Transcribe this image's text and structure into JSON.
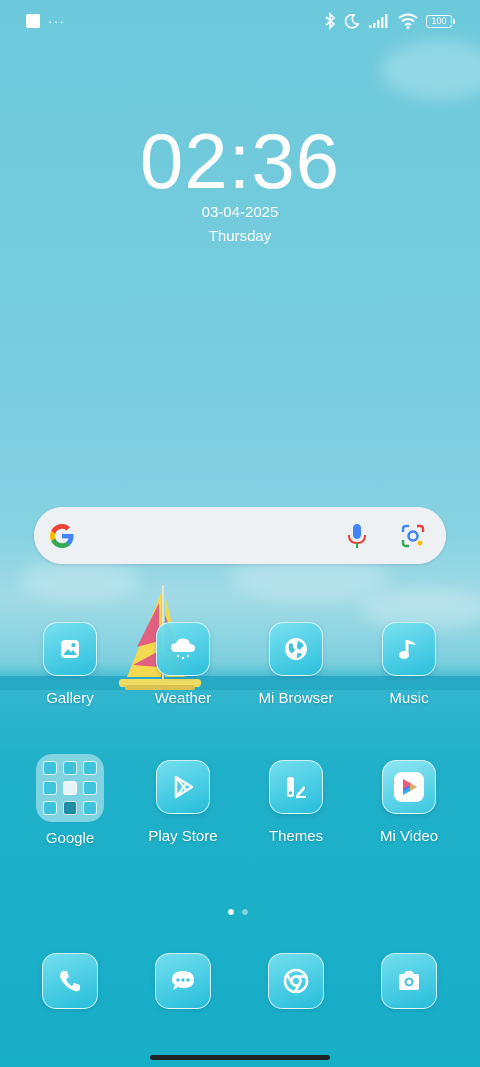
{
  "status_bar": {
    "more_indicator": "···",
    "battery_level": "100",
    "icons": [
      "bluetooth-icon",
      "moon-icon",
      "signal-icon",
      "wifi-icon",
      "battery-icon"
    ]
  },
  "clock": {
    "time": "02:36",
    "date": "03-04-2025",
    "day": "Thursday"
  },
  "search": {
    "icons": [
      "google-logo",
      "mic-icon",
      "lens-icon"
    ]
  },
  "apps": [
    {
      "label": "Gallery",
      "icon": "gallery-icon"
    },
    {
      "label": "Weather",
      "icon": "weather-icon"
    },
    {
      "label": "Mi Browser",
      "icon": "globe-icon"
    },
    {
      "label": "Music",
      "icon": "music-note-icon"
    },
    {
      "label": "Google",
      "icon": "folder-icon"
    },
    {
      "label": "Play Store",
      "icon": "play-store-icon"
    },
    {
      "label": "Themes",
      "icon": "themes-icon"
    },
    {
      "label": "Mi Video",
      "icon": "video-play-icon"
    }
  ],
  "dock": [
    {
      "icon": "phone-icon"
    },
    {
      "icon": "messages-icon"
    },
    {
      "icon": "chrome-icon"
    },
    {
      "icon": "camera-icon"
    }
  ],
  "page_indicator": {
    "pages": 2,
    "current": 1
  },
  "colors": {
    "icon_accent": "#3ec3dc",
    "search_bar": "#eef1f3"
  }
}
